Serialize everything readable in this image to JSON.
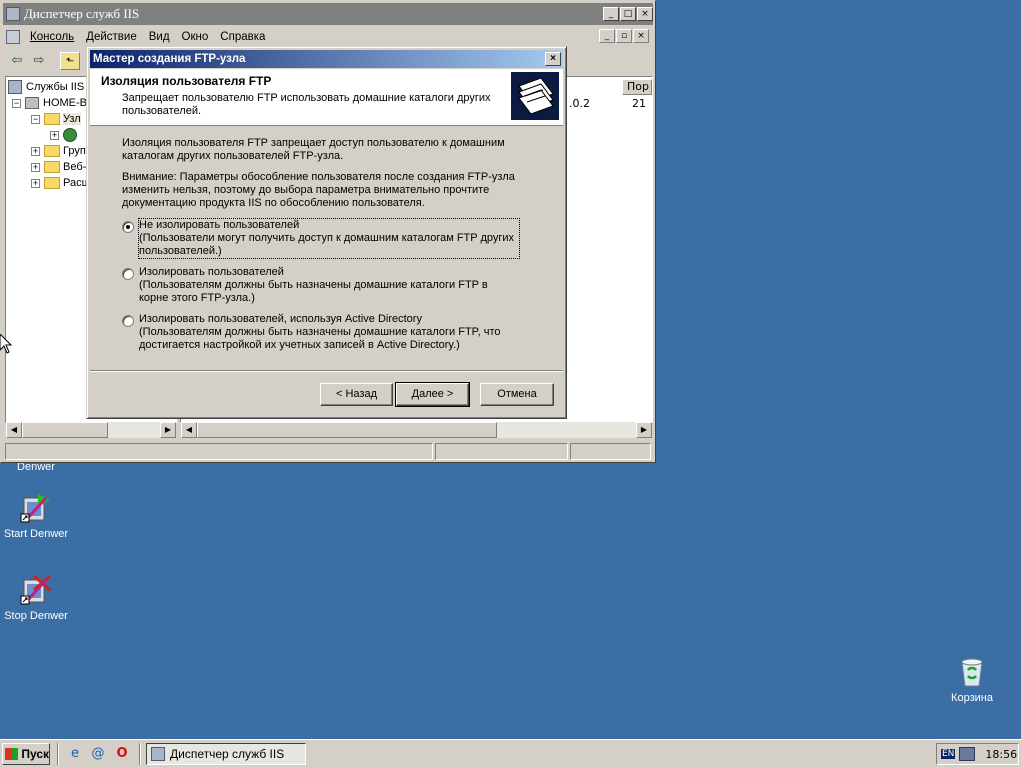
{
  "iis_window": {
    "title": "Диспетчер служб IIS",
    "title_buttons": [
      "_",
      "□",
      "×"
    ],
    "menu": [
      "Консоль",
      "Действие",
      "Вид",
      "Окно",
      "Справка"
    ],
    "inner_buttons": [
      "_",
      "▫",
      "×"
    ],
    "tree": [
      {
        "label": "Службы IIS",
        "expander": ""
      },
      {
        "label": "HOME-B",
        "expander": "−"
      },
      {
        "label": "Узл",
        "expander": "−"
      },
      {
        "label": "",
        "expander": "+"
      },
      {
        "label": "Груп",
        "expander": "+"
      },
      {
        "label": "Веб-",
        "expander": "+"
      },
      {
        "label": "Расш",
        "expander": "+"
      }
    ],
    "list_columns": [
      "Пор"
    ],
    "list_row": {
      "ip_fragment": ".0.2",
      "port": "21"
    }
  },
  "wizard": {
    "title": "Мастер создания FTP-узла",
    "header_title": "Изоляция пользователя FTP",
    "header_subtitle": "Запрещает пользователю FTP использовать домашние каталоги других пользователей.",
    "description": "Изоляция пользователя FTP запрещает доступ пользователю к домашним каталогам других пользователей FTP-узла.",
    "warning": "Внимание: Параметры обособление пользователя после создания FTP-узла изменить нельзя, поэтому до выбора параметра внимательно прочтите документацию продукта IIS по обособлению пользователя.",
    "options": [
      {
        "title": "Не изолировать пользователей",
        "detail": "(Пользователи могут получить доступ к домашним каталогам FTP других пользователей.)",
        "selected": true
      },
      {
        "title": "Изолировать пользователей",
        "detail": "(Пользователям должны быть назначены домашние каталоги FTP в корне этого FTP-узла.)",
        "selected": false
      },
      {
        "title": "Изолировать пользователей, используя Active Directory",
        "detail": "(Пользователям должны быть назначены домашние каталоги FTP, что достигается настройкой их учетных записей в Active Directory.)",
        "selected": false
      }
    ],
    "buttons": {
      "back": "< Назад",
      "next": "Далее >",
      "cancel": "Отмена"
    }
  },
  "desktop_icons": [
    {
      "label": "Denwer",
      "icon": "denwer-icon"
    },
    {
      "label": "Start Denwer",
      "icon": "start-denwer-icon"
    },
    {
      "label": "Stop Denwer",
      "icon": "stop-denwer-icon"
    },
    {
      "label": "Корзина",
      "icon": "recycle-bin-icon"
    }
  ],
  "taskbar": {
    "start_label": "Пуск",
    "task_label": "Диспетчер служб IIS",
    "lang": "EN",
    "clock": "18:56"
  }
}
